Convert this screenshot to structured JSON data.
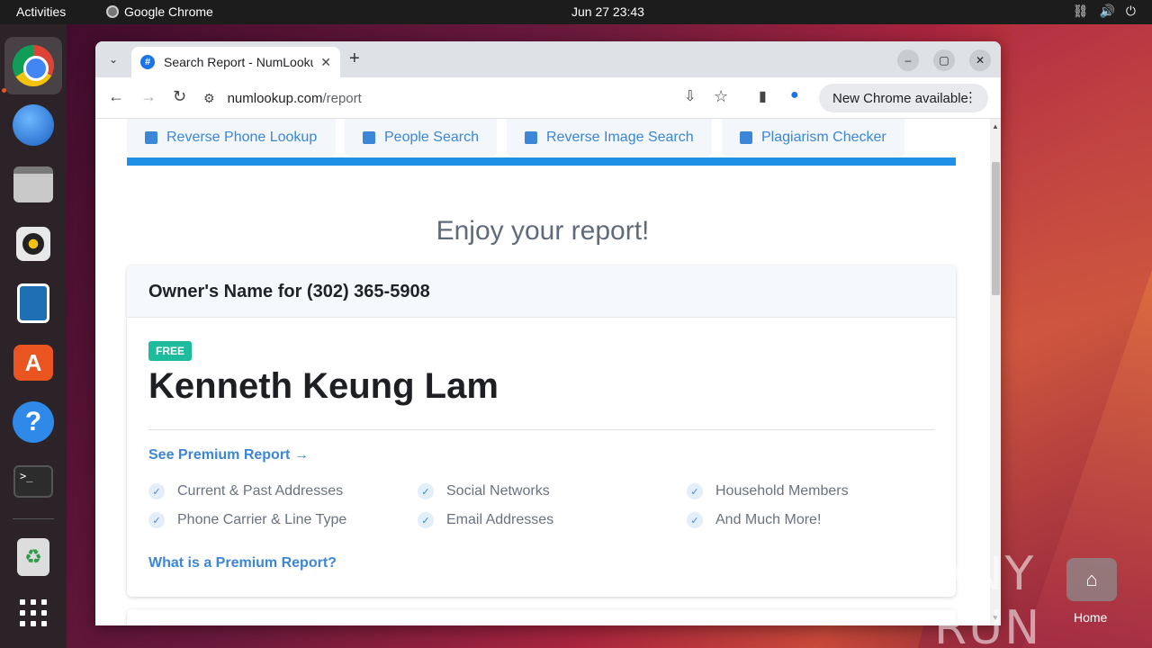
{
  "topbar": {
    "activities": "Activities",
    "app_name": "Google Chrome",
    "clock": "Jun 27  23:43"
  },
  "dock": {
    "items": [
      "chrome",
      "thunderbird",
      "files",
      "rhythmbox",
      "libreoffice-writer",
      "app-center",
      "help",
      "terminal",
      "trash",
      "show-apps"
    ]
  },
  "browser": {
    "tab_title": "Search Report - NumLookup",
    "url_host": "numlookup.com",
    "url_path": "/report",
    "update_label": "New Chrome available"
  },
  "page": {
    "nav_tabs": [
      {
        "label": "Reverse Phone Lookup"
      },
      {
        "label": "People Search"
      },
      {
        "label": "Reverse Image Search"
      },
      {
        "label": "Plagiarism Checker"
      }
    ],
    "heading": "Enjoy your report!",
    "card": {
      "title": "Owner's Name for (302) 365-5908",
      "badge": "FREE",
      "name": "Kenneth Keung Lam",
      "premium_link": "See Premium Report →",
      "features": [
        "Current & Past Addresses",
        "Social Networks",
        "Household Members",
        "Phone Carrier & Line Type",
        "Email Addresses",
        "And Much More!"
      ],
      "what_link": "What is a Premium Report?"
    }
  },
  "desktop": {
    "watermark": "ANY RUN",
    "home_label": "Home"
  },
  "colors": {
    "accent_blue": "#3b86d6",
    "bar_blue": "#1e90e6",
    "badge_green": "#1cbc9c"
  }
}
